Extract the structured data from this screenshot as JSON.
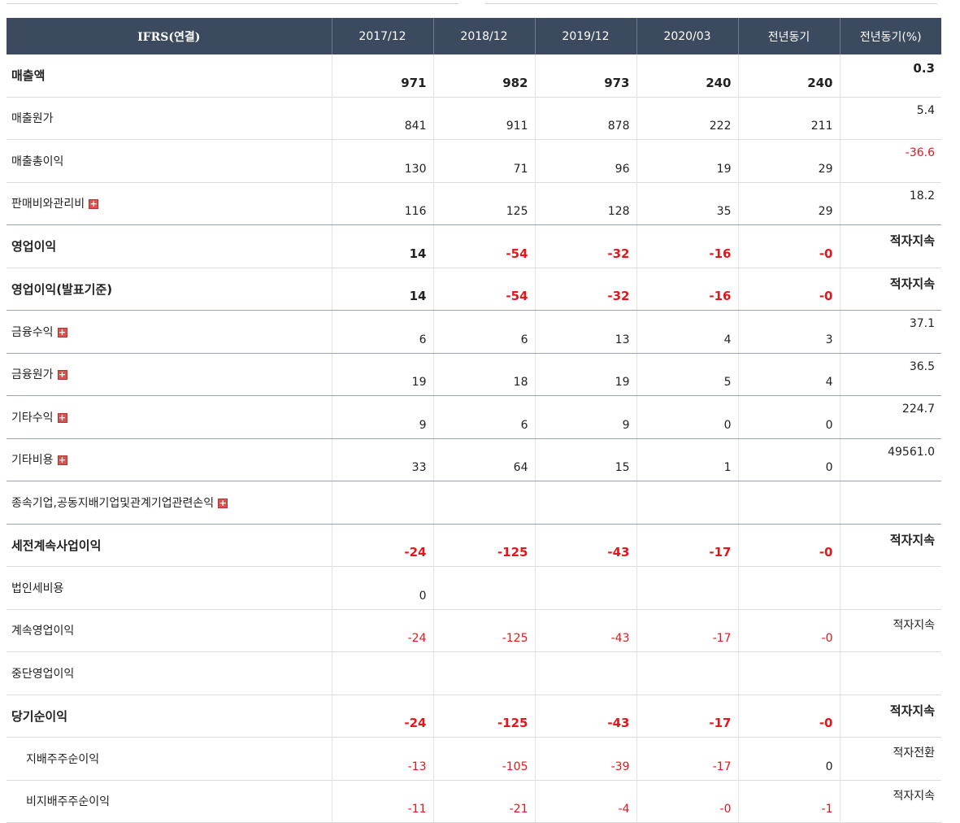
{
  "colors": {
    "header_bg": "#3b4a5e",
    "negative": "#e4161b",
    "expand_button": "#d9534f"
  },
  "header": [
    "IFRS(연결)",
    "2017/12",
    "2018/12",
    "2019/12",
    "2020/03",
    "전년동기",
    "전년동기(%)"
  ],
  "expand_icon": "+",
  "rows": [
    {
      "label": "매출액",
      "bold": true,
      "cells": [
        "971",
        "982",
        "973",
        "240",
        "240",
        "0.3"
      ]
    },
    {
      "label": "매출원가",
      "cells": [
        "841",
        "911",
        "878",
        "222",
        "211",
        "5.4"
      ]
    },
    {
      "label": "매출총이익",
      "cells": [
        "130",
        "71",
        "96",
        "19",
        "29",
        "-36.6"
      ]
    },
    {
      "label": "판매비와관리비",
      "expand": true,
      "sep": true,
      "cells": [
        "116",
        "125",
        "128",
        "35",
        "29",
        "18.2"
      ]
    },
    {
      "label": "영업이익",
      "bold": true,
      "cells": [
        "14",
        "-54",
        "-32",
        "-16",
        "-0",
        "적자지속"
      ]
    },
    {
      "label": "영업이익(발표기준)",
      "bold": true,
      "sep": true,
      "cells": [
        "14",
        "-54",
        "-32",
        "-16",
        "-0",
        "적자지속"
      ]
    },
    {
      "label": "금융수익",
      "expand": true,
      "sep": true,
      "cells": [
        "6",
        "6",
        "13",
        "4",
        "3",
        "37.1"
      ]
    },
    {
      "label": "금융원가",
      "expand": true,
      "sep": true,
      "cells": [
        "19",
        "18",
        "19",
        "5",
        "4",
        "36.5"
      ]
    },
    {
      "label": "기타수익",
      "expand": true,
      "sep": true,
      "cells": [
        "9",
        "6",
        "9",
        "0",
        "0",
        "224.7"
      ]
    },
    {
      "label": "기타비용",
      "expand": true,
      "sep": true,
      "cells": [
        "33",
        "64",
        "15",
        "1",
        "0",
        "49561.0"
      ]
    },
    {
      "label": "종속기업,공동지배기업및관계기업관련손익",
      "expand": true,
      "sep": true,
      "cells": [
        "",
        "",
        "",
        "",
        "",
        ""
      ]
    },
    {
      "label": "세전계속사업이익",
      "bold": true,
      "cells": [
        "-24",
        "-125",
        "-43",
        "-17",
        "-0",
        "적자지속"
      ]
    },
    {
      "label": "법인세비용",
      "cells": [
        "0",
        "",
        "",
        "",
        "",
        ""
      ]
    },
    {
      "label": "계속영업이익",
      "cells": [
        "-24",
        "-125",
        "-43",
        "-17",
        "-0",
        "적자지속"
      ]
    },
    {
      "label": "중단영업이익",
      "cells": [
        "",
        "",
        "",
        "",
        "",
        ""
      ]
    },
    {
      "label": "당기순이익",
      "bold": true,
      "cells": [
        "-24",
        "-125",
        "-43",
        "-17",
        "-0",
        "적자지속"
      ]
    },
    {
      "label": "지배주주순이익",
      "sub": true,
      "cells": [
        "-13",
        "-105",
        "-39",
        "-17",
        "0",
        "적자전환"
      ]
    },
    {
      "label": "비지배주주순이익",
      "sub": true,
      "cells": [
        "-11",
        "-21",
        "-4",
        "-0",
        "-1",
        "적자지속"
      ]
    }
  ]
}
